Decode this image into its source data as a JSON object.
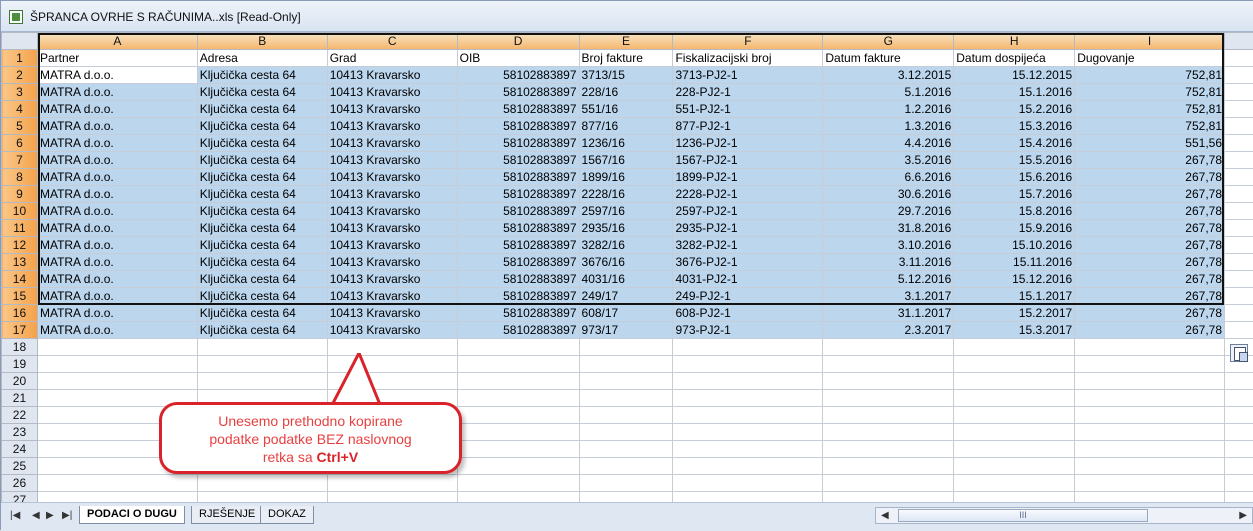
{
  "window": {
    "title": "ŠPRANCA OVRHE S RAČUNIMA..xls  [Read-Only]"
  },
  "columns": [
    "A",
    "B",
    "C",
    "D",
    "E",
    "F",
    "G",
    "H",
    "I"
  ],
  "rows_total": 27,
  "header_row": [
    "Partner",
    "Adresa",
    "Grad",
    "OIB",
    "Broj fakture",
    "Fiskalizacijski broj",
    "Datum fakture",
    "Datum dospijeća",
    "Dugovanje"
  ],
  "data_rows": [
    [
      "MATRA d.o.o.",
      "Ključička cesta 64",
      "10413 Kravarsko",
      "58102883897",
      "3713/15",
      "3713-PJ2-1",
      "3.12.2015",
      "15.12.2015",
      "752,81"
    ],
    [
      "MATRA d.o.o.",
      "Ključička cesta 64",
      "10413 Kravarsko",
      "58102883897",
      "228/16",
      "228-PJ2-1",
      "5.1.2016",
      "15.1.2016",
      "752,81"
    ],
    [
      "MATRA d.o.o.",
      "Ključička cesta 64",
      "10413 Kravarsko",
      "58102883897",
      "551/16",
      "551-PJ2-1",
      "1.2.2016",
      "15.2.2016",
      "752,81"
    ],
    [
      "MATRA d.o.o.",
      "Ključička cesta 64",
      "10413 Kravarsko",
      "58102883897",
      "877/16",
      "877-PJ2-1",
      "1.3.2016",
      "15.3.2016",
      "752,81"
    ],
    [
      "MATRA d.o.o.",
      "Ključička cesta 64",
      "10413 Kravarsko",
      "58102883897",
      "1236/16",
      "1236-PJ2-1",
      "4.4.2016",
      "15.4.2016",
      "551,56"
    ],
    [
      "MATRA d.o.o.",
      "Ključička cesta 64",
      "10413 Kravarsko",
      "58102883897",
      "1567/16",
      "1567-PJ2-1",
      "3.5.2016",
      "15.5.2016",
      "267,78"
    ],
    [
      "MATRA d.o.o.",
      "Ključička cesta 64",
      "10413 Kravarsko",
      "58102883897",
      "1899/16",
      "1899-PJ2-1",
      "6.6.2016",
      "15.6.2016",
      "267,78"
    ],
    [
      "MATRA d.o.o.",
      "Ključička cesta 64",
      "10413 Kravarsko",
      "58102883897",
      "2228/16",
      "2228-PJ2-1",
      "30.6.2016",
      "15.7.2016",
      "267,78"
    ],
    [
      "MATRA d.o.o.",
      "Ključička cesta 64",
      "10413 Kravarsko",
      "58102883897",
      "2597/16",
      "2597-PJ2-1",
      "29.7.2016",
      "15.8.2016",
      "267,78"
    ],
    [
      "MATRA d.o.o.",
      "Ključička cesta 64",
      "10413 Kravarsko",
      "58102883897",
      "2935/16",
      "2935-PJ2-1",
      "31.8.2016",
      "15.9.2016",
      "267,78"
    ],
    [
      "MATRA d.o.o.",
      "Ključička cesta 64",
      "10413 Kravarsko",
      "58102883897",
      "3282/16",
      "3282-PJ2-1",
      "3.10.2016",
      "15.10.2016",
      "267,78"
    ],
    [
      "MATRA d.o.o.",
      "Ključička cesta 64",
      "10413 Kravarsko",
      "58102883897",
      "3676/16",
      "3676-PJ2-1",
      "3.11.2016",
      "15.11.2016",
      "267,78"
    ],
    [
      "MATRA d.o.o.",
      "Ključička cesta 64",
      "10413 Kravarsko",
      "58102883897",
      "4031/16",
      "4031-PJ2-1",
      "5.12.2016",
      "15.12.2016",
      "267,78"
    ],
    [
      "MATRA d.o.o.",
      "Ključička cesta 64",
      "10413 Kravarsko",
      "58102883897",
      "249/17",
      "249-PJ2-1",
      "3.1.2017",
      "15.1.2017",
      "267,78"
    ],
    [
      "MATRA d.o.o.",
      "Ključička cesta 64",
      "10413 Kravarsko",
      "58102883897",
      "608/17",
      "608-PJ2-1",
      "31.1.2017",
      "15.2.2017",
      "267,78"
    ],
    [
      "MATRA d.o.o.",
      "Ključička cesta 64",
      "10413 Kravarsko",
      "58102883897",
      "973/17",
      "973-PJ2-1",
      "2.3.2017",
      "15.3.2017",
      "267,78"
    ]
  ],
  "callout": {
    "line1": "Unesemo prethodno kopirane",
    "line2": "podatke podatke BEZ naslovnog",
    "line3_prefix": "retka sa",
    "line3_bold": "Ctrl+V"
  },
  "sheet_tabs": [
    "PODACI O DUGU",
    "RJEŠENJE",
    "DOKAZ"
  ],
  "nav": {
    "first": "|◀",
    "prev": "◀",
    "next": "▶",
    "last": "▶|"
  },
  "scroll": {
    "left": "◀",
    "thumb": "III",
    "right": "▶"
  },
  "icons": {
    "app": "excel-file-icon",
    "paste": "paste-options-icon"
  },
  "colors": {
    "selection": "#bcd6ee",
    "header": "#f5b66b",
    "callout_border": "#d9232a",
    "callout_text": "#e74040"
  }
}
